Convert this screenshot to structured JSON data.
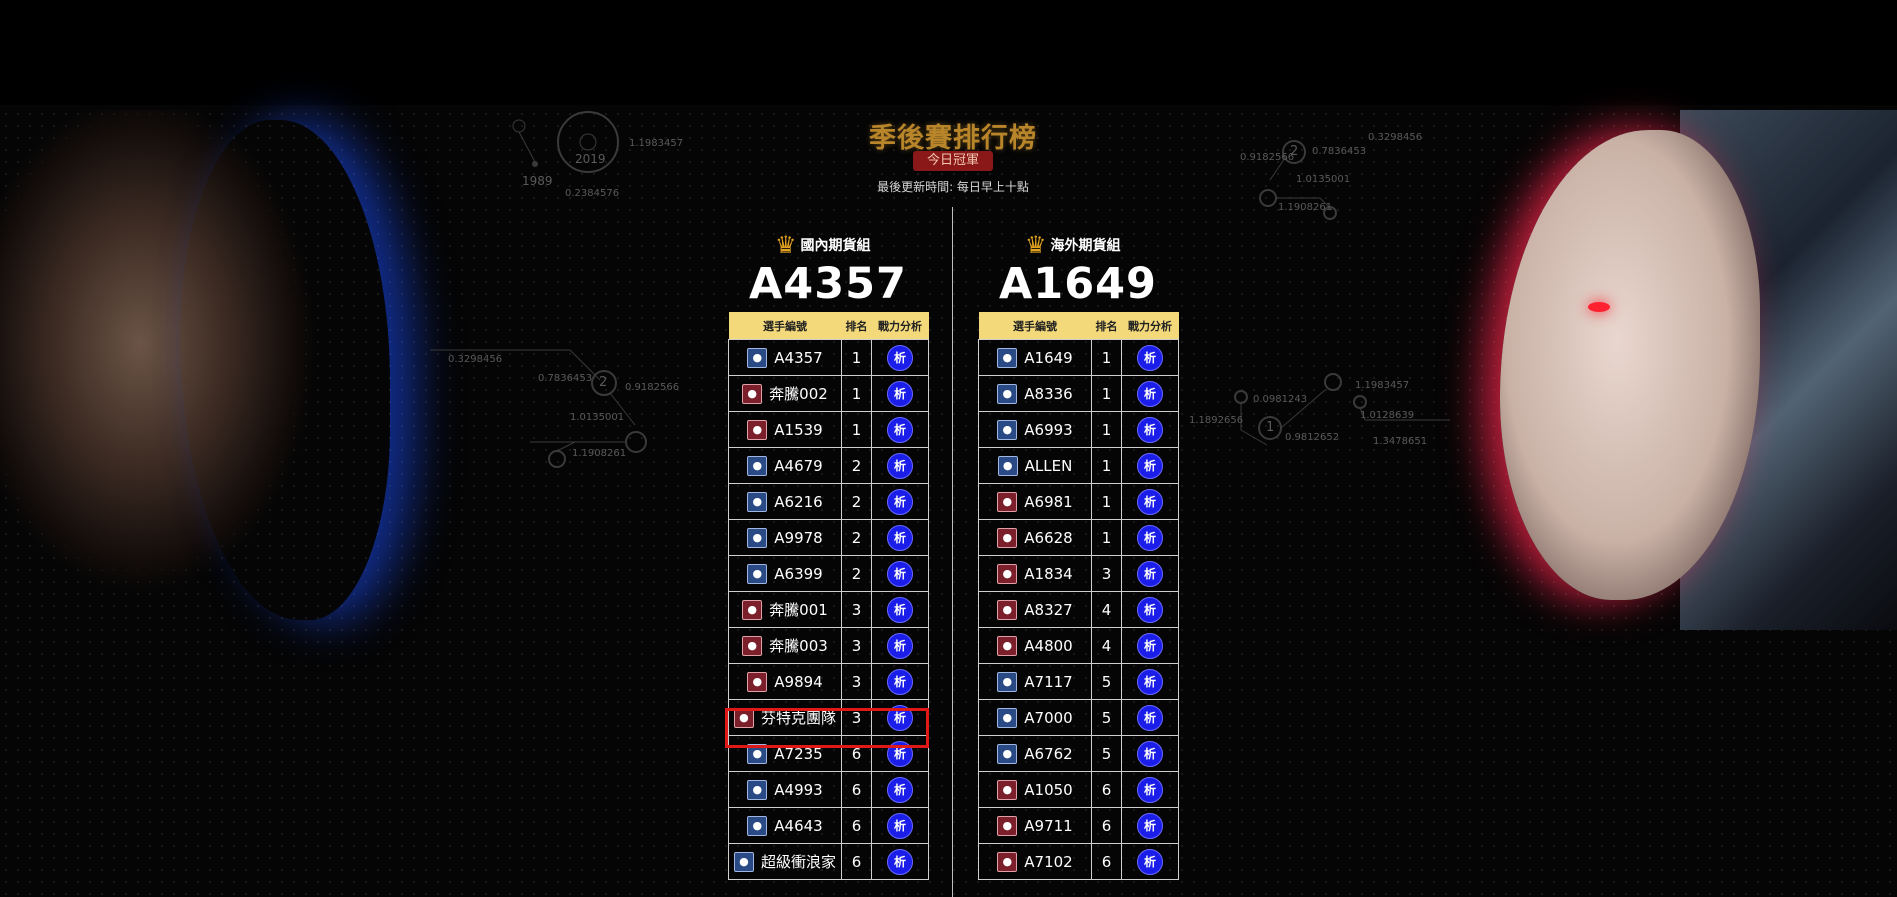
{
  "page": {
    "title": "季後賽排行榜",
    "champion_badge": "今日冠軍",
    "update_time": "最後更新時間: 每日早上十點"
  },
  "hud_left_top": {
    "year1": "2019",
    "year2": "1989",
    "n1": "1.1983457",
    "n2": "0.2384576"
  },
  "hud_left_mid": {
    "n1": "0.3298456",
    "n2": "0.7836453",
    "n3": "0.9182566",
    "n4": "1.0135001",
    "n5": "1.1908261",
    "node": "2"
  },
  "hud_right_top": {
    "n1": "0.9182566",
    "n2": "0.7836453",
    "n3": "1.0135001",
    "n4": "1.1908261",
    "n5": "0.3298456",
    "node": "2"
  },
  "hud_right_mid": {
    "n1": "0.0981243",
    "n2": "1.1983457",
    "n3": "1.1892656",
    "n4": "0.9812652",
    "n5": "1.0128639",
    "n6": "1.3478651",
    "node": "1"
  },
  "domestic": {
    "title": "國內期貨組",
    "champion": "A4357",
    "headers": [
      "選手編號",
      "排名",
      "戰力分析"
    ],
    "rows": [
      {
        "player": "A4357",
        "rank": "1",
        "avatar": "male",
        "btn": "析"
      },
      {
        "player": "奔騰002",
        "rank": "1",
        "avatar": "female",
        "btn": "析"
      },
      {
        "player": "A1539",
        "rank": "1",
        "avatar": "female",
        "btn": "析"
      },
      {
        "player": "A4679",
        "rank": "2",
        "avatar": "male",
        "btn": "析"
      },
      {
        "player": "A6216",
        "rank": "2",
        "avatar": "male",
        "btn": "析"
      },
      {
        "player": "A9978",
        "rank": "2",
        "avatar": "male",
        "btn": "析"
      },
      {
        "player": "A6399",
        "rank": "2",
        "avatar": "male",
        "btn": "析"
      },
      {
        "player": "奔騰001",
        "rank": "3",
        "avatar": "female",
        "btn": "析"
      },
      {
        "player": "奔騰003",
        "rank": "3",
        "avatar": "female",
        "btn": "析"
      },
      {
        "player": "A9894",
        "rank": "3",
        "avatar": "female",
        "btn": "析"
      },
      {
        "player": "芬特克團隊",
        "rank": "3",
        "avatar": "female",
        "btn": "析"
      },
      {
        "player": "A7235",
        "rank": "6",
        "avatar": "male",
        "btn": "析"
      },
      {
        "player": "A4993",
        "rank": "6",
        "avatar": "male",
        "btn": "析"
      },
      {
        "player": "A4643",
        "rank": "6",
        "avatar": "male",
        "btn": "析"
      },
      {
        "player": "超級衝浪家",
        "rank": "6",
        "avatar": "male",
        "btn": "析"
      }
    ]
  },
  "overseas": {
    "title": "海外期貨組",
    "champion": "A1649",
    "headers": [
      "選手編號",
      "排名",
      "戰力分析"
    ],
    "rows": [
      {
        "player": "A1649",
        "rank": "1",
        "avatar": "male",
        "btn": "析"
      },
      {
        "player": "A8336",
        "rank": "1",
        "avatar": "male",
        "btn": "析"
      },
      {
        "player": "A6993",
        "rank": "1",
        "avatar": "male",
        "btn": "析"
      },
      {
        "player": "ALLEN",
        "rank": "1",
        "avatar": "male",
        "btn": "析"
      },
      {
        "player": "A6981",
        "rank": "1",
        "avatar": "female",
        "btn": "析"
      },
      {
        "player": "A6628",
        "rank": "1",
        "avatar": "female",
        "btn": "析"
      },
      {
        "player": "A1834",
        "rank": "3",
        "avatar": "female",
        "btn": "析"
      },
      {
        "player": "A8327",
        "rank": "4",
        "avatar": "female",
        "btn": "析"
      },
      {
        "player": "A4800",
        "rank": "4",
        "avatar": "female",
        "btn": "析"
      },
      {
        "player": "A7117",
        "rank": "5",
        "avatar": "male",
        "btn": "析"
      },
      {
        "player": "A7000",
        "rank": "5",
        "avatar": "male",
        "btn": "析"
      },
      {
        "player": "A6762",
        "rank": "5",
        "avatar": "male",
        "btn": "析"
      },
      {
        "player": "A1050",
        "rank": "6",
        "avatar": "female",
        "btn": "析"
      },
      {
        "player": "A9711",
        "rank": "6",
        "avatar": "female",
        "btn": "析"
      },
      {
        "player": "A7102",
        "rank": "6",
        "avatar": "female",
        "btn": "析"
      }
    ]
  },
  "colors": {
    "header_bg": "#f4d97a",
    "analysis_button": "#1a1ee8",
    "highlight_border": "#e01818",
    "title_gold": "#b8852a",
    "badge_red": "#8a1818"
  }
}
